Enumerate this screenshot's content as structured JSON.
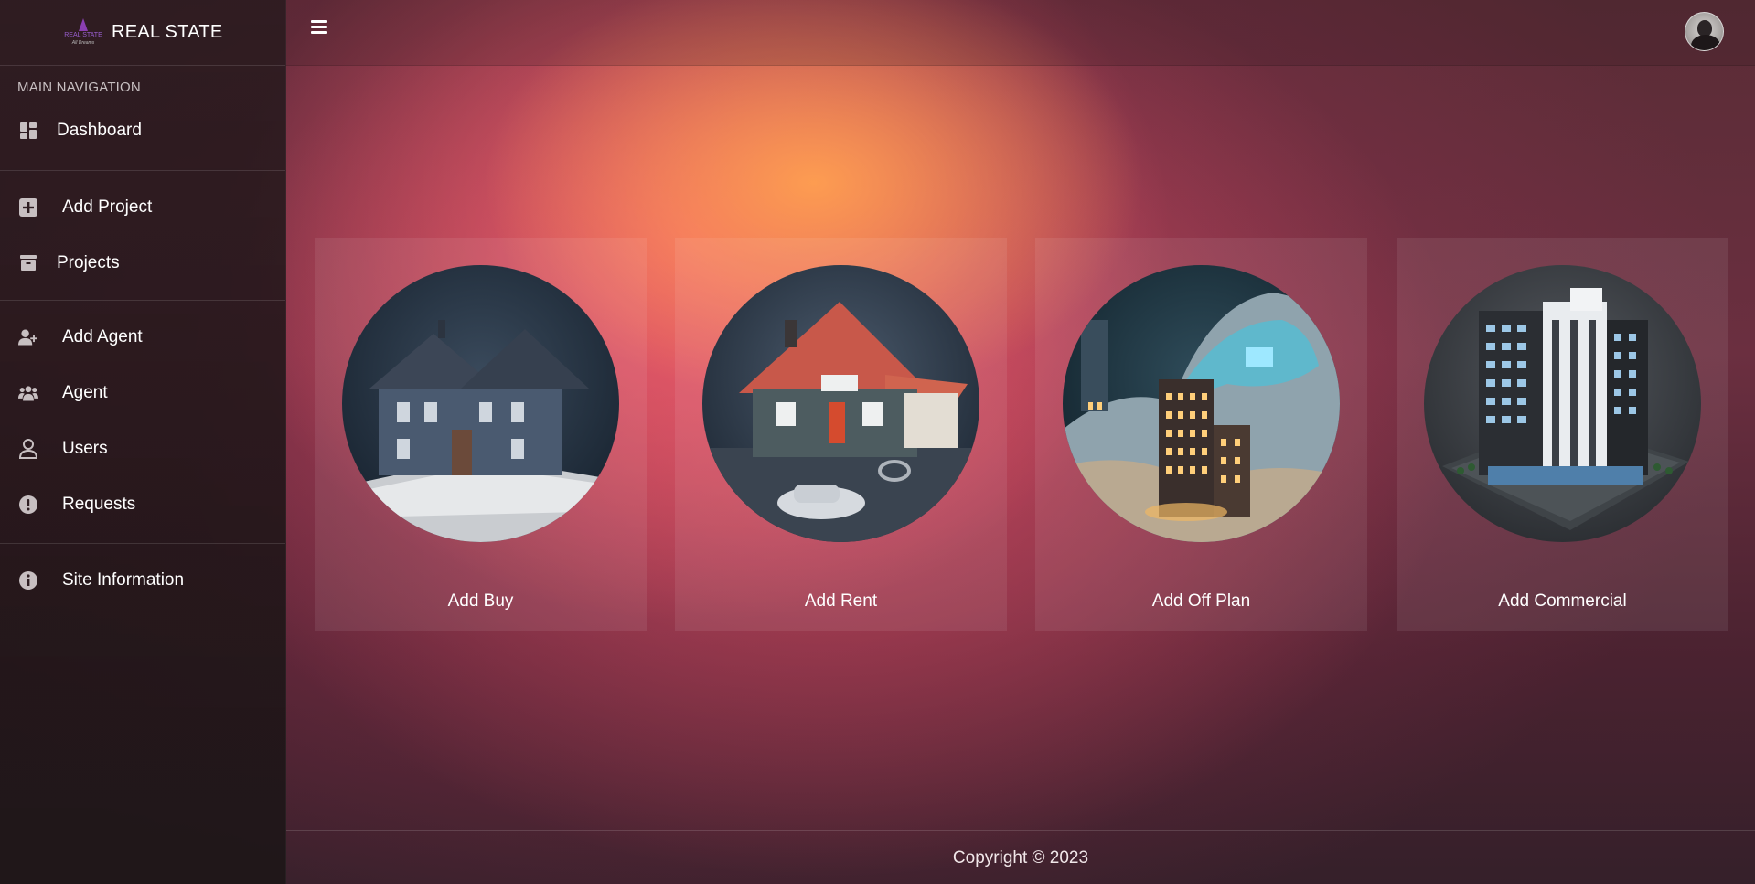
{
  "brand": {
    "title": "REAL STATE",
    "logo_text": "REAL STATE",
    "logo_subtext": "All Dreams"
  },
  "sidebar": {
    "header": "MAIN NAVIGATION",
    "items": [
      {
        "label": "Dashboard",
        "icon": "dashboard-icon"
      },
      {
        "label": "Add Project",
        "icon": "plus-square-icon"
      },
      {
        "label": "Projects",
        "icon": "archive-box-icon"
      },
      {
        "label": "Add Agent",
        "icon": "user-plus-icon"
      },
      {
        "label": "Agent",
        "icon": "users-group-icon"
      },
      {
        "label": "Users",
        "icon": "user-outline-icon"
      },
      {
        "label": "Requests",
        "icon": "exclamation-circle-icon"
      },
      {
        "label": "Site Information",
        "icon": "info-circle-icon"
      }
    ]
  },
  "topbar": {
    "menu_icon": "hamburger-icon",
    "avatar_icon": "user-avatar"
  },
  "cards": [
    {
      "label": "Add Buy",
      "image": "house-blueprint-illustration"
    },
    {
      "label": "Add Rent",
      "image": "house-with-car-and-keys-illustration"
    },
    {
      "label": "Add Off Plan",
      "image": "city-buildings-in-sand-illustration"
    },
    {
      "label": "Add Commercial",
      "image": "commercial-tower-illustration"
    }
  ],
  "footer": {
    "copyright": "Copyright © 2023"
  }
}
